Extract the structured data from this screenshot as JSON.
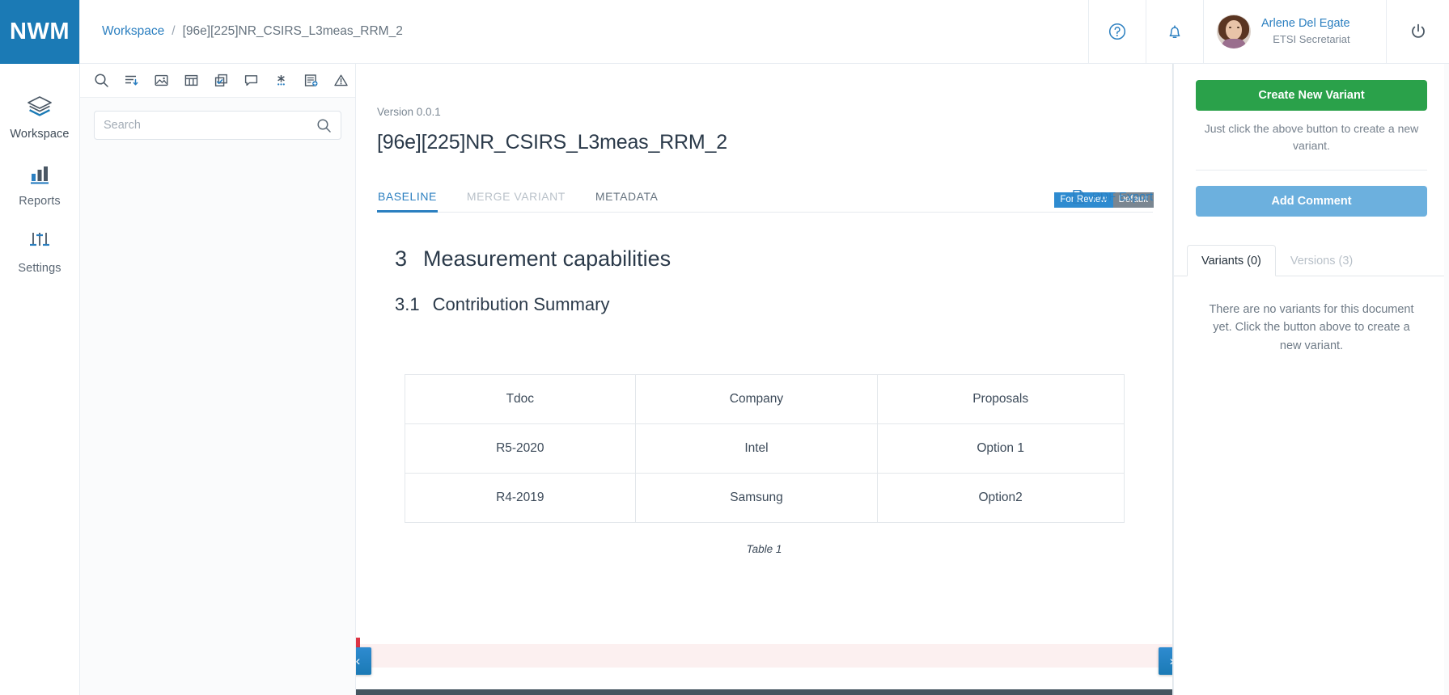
{
  "brand": {
    "logo": "NWM",
    "logo_bg": "#1b7ab5"
  },
  "rail": {
    "items": [
      {
        "label": "Workspace",
        "icon": "layers-icon",
        "active": true
      },
      {
        "label": "Reports",
        "icon": "bar-chart-icon",
        "active": false
      },
      {
        "label": "Settings",
        "icon": "sliders-icon",
        "active": false
      }
    ]
  },
  "topbar": {
    "breadcrumb": {
      "root": "Workspace",
      "separator": "/",
      "current": "[96e][225]NR_CSIRS_L3meas_RRM_2"
    },
    "help_icon": "help-circle-icon",
    "notifications_icon": "bell-icon",
    "user": {
      "name": "Arlene Del Egate",
      "role": "ETSI Secretariat",
      "avatar": "user-avatar"
    },
    "power_icon": "power-icon"
  },
  "toolpanel": {
    "icons": [
      "search-icon",
      "sort-descending-icon",
      "image-icon",
      "table-icon",
      "copy-icon",
      "comment-icon",
      "asterisk-icon",
      "export-note-icon",
      "warning-icon"
    ],
    "search": {
      "placeholder": "Search",
      "value": ""
    }
  },
  "document": {
    "version": "Version 0.0.1",
    "title": "[96e][225]NR_CSIRS_L3meas_RRM_2",
    "badges": [
      {
        "label": "For Review",
        "color": "#2e8bd0"
      },
      {
        "label": "Default",
        "color": "#7a8691"
      }
    ],
    "tabs": [
      {
        "label": "BASELINE",
        "state": "active"
      },
      {
        "label": "MERGE VARIANT",
        "state": "disabled"
      },
      {
        "label": "METADATA",
        "state": "normal"
      }
    ],
    "pdf_export": {
      "label": "PDF Export",
      "icon": "pdf-file-icon"
    },
    "headings": [
      {
        "number": "3",
        "text": "Measurement capabilities",
        "level": 1
      },
      {
        "number": "3.1",
        "text": "Contribution Summary",
        "level": 2
      }
    ],
    "table": {
      "headers": [
        "Tdoc",
        "Company",
        "Proposals"
      ],
      "rows": [
        [
          "R5-2020",
          "Intel",
          "Option 1"
        ],
        [
          "R4-2019",
          "Samsung",
          "Option2"
        ]
      ],
      "caption": "Table 1"
    },
    "nav": {
      "prev": "‹",
      "next": "›"
    }
  },
  "rightpanel": {
    "create_variant_label": "Create New Variant",
    "create_variant_hint": "Just click the above button to create a new variant.",
    "add_comment_label": "Add Comment",
    "tabs": [
      {
        "label": "Variants (0)",
        "active": true
      },
      {
        "label": "Versions (3)",
        "active": false
      }
    ],
    "empty_message": "There are no variants for this document yet. Click the button above to create a new variant."
  }
}
